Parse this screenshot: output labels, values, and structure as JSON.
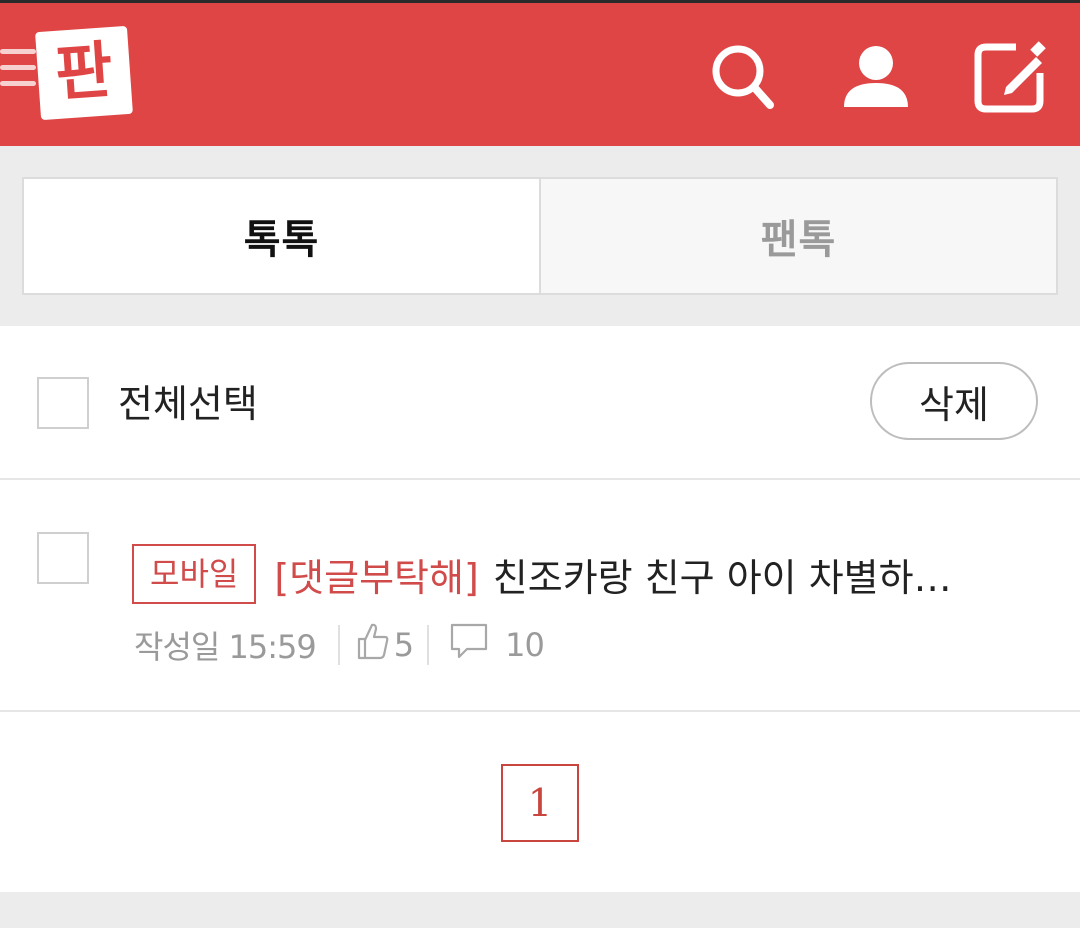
{
  "header": {
    "logo_text": "판",
    "icons": [
      "menu-icon",
      "search-icon",
      "user-icon",
      "write-icon"
    ],
    "brand_color": "#e04545"
  },
  "tabs": [
    {
      "label": "톡톡",
      "active": true
    },
    {
      "label": "팬톡",
      "active": false
    }
  ],
  "list": {
    "select_all_label": "전체선택",
    "delete_label": "삭제",
    "posts": [
      {
        "badge": "모바일",
        "tag": "[댓글부탁해]",
        "title": "친조카랑 친구 아이 차별하…",
        "date": "작성일 15:59",
        "likes": "5",
        "comments": "10"
      }
    ]
  },
  "pagination": {
    "current_page": "1"
  }
}
